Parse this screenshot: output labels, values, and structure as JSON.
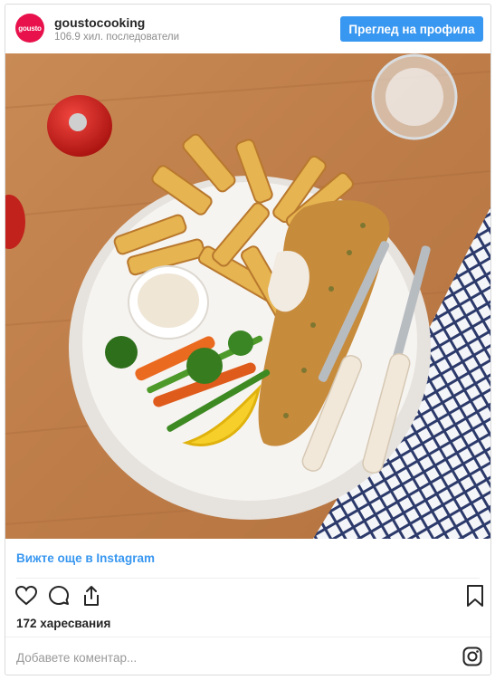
{
  "header": {
    "avatar_text": "gousto",
    "username": "gousto​cooking",
    "followers": "106.9 хил. последователи",
    "profile_button": "Преглед на профила"
  },
  "post": {
    "more_link": "Вижте още в Instagram",
    "likes": "172 харесвания",
    "comment_placeholder": "Добавете коментар..."
  },
  "icons": {
    "like": "heart-icon",
    "comment": "comment-bubble-icon",
    "share": "share-icon",
    "save": "bookmark-icon",
    "instagram": "instagram-logo-icon"
  },
  "colors": {
    "brand": "#e8114b",
    "accent": "#3897f0",
    "text": "#262626",
    "muted": "#8e8e8e"
  }
}
